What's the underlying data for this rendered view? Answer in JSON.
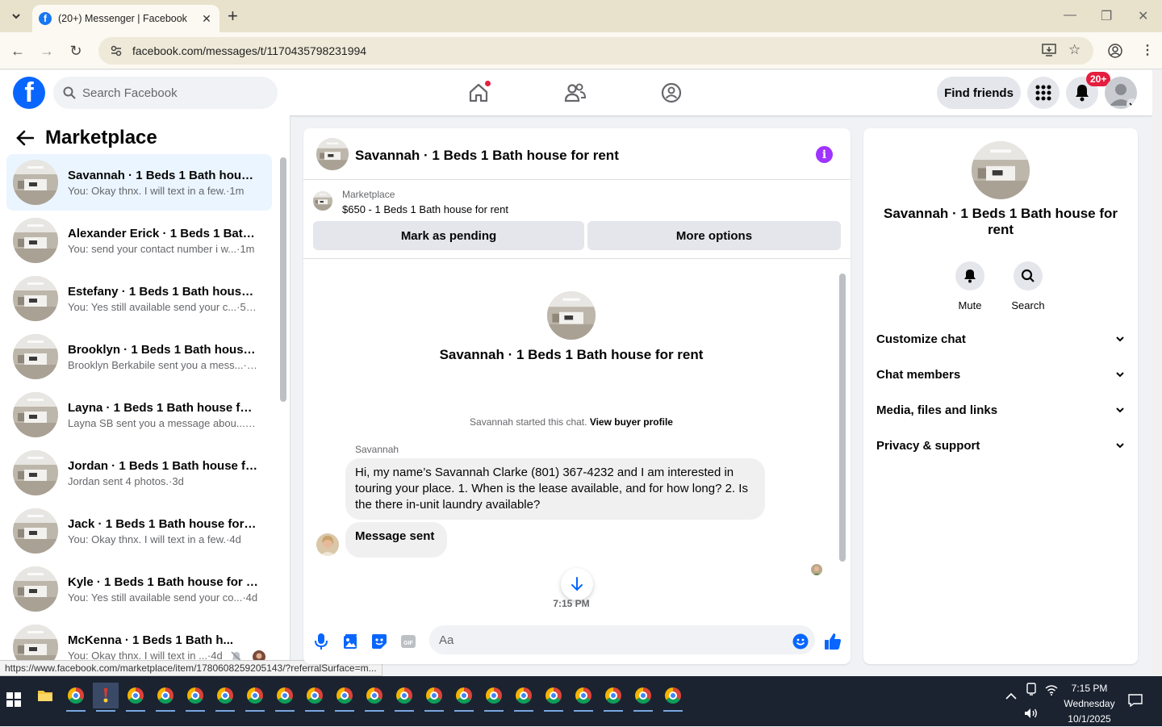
{
  "browser": {
    "tab_title": "(20+) Messenger | Facebook",
    "url": "facebook.com/messages/t/1170435798231994",
    "status_url": "https://www.facebook.com/marketplace/item/1780608259205143/?referralSurface=m..."
  },
  "header": {
    "search_placeholder": "Search Facebook",
    "find_friends": "Find friends",
    "notif_badge": "20+"
  },
  "sidebar": {
    "title": "Marketplace",
    "conversations": [
      {
        "name": "Savannah · 1 Beds 1 Bath house f...",
        "preview": "You: Okay thnx. I will text in a few.",
        "time": "1m"
      },
      {
        "name": "Alexander Erick · 1 Beds 1 Bath h...",
        "preview": "You: send your contact number i w...",
        "time": "1m"
      },
      {
        "name": "Estefany · 1 Beds 1 Bath house fo...",
        "preview": "You: Yes still available send your c...",
        "time": "50m"
      },
      {
        "name": "Brooklyn · 1 Beds 1 Bath house f...",
        "preview": "Brooklyn Berkabile sent you a mess...",
        "time": "1d"
      },
      {
        "name": "Layna · 1 Beds 1 Bath house for r...",
        "preview": "Layna SB sent you a message abou...",
        "time": "1d"
      },
      {
        "name": "Jordan · 1 Beds 1 Bath house for ...",
        "preview": "Jordan sent 4 photos.",
        "time": "3d"
      },
      {
        "name": "Jack · 1 Beds 1 Bath house for rent",
        "preview": "You: Okay thnx. I will text in a few.",
        "time": "4d"
      },
      {
        "name": "Kyle · 1 Beds 1 Bath house for rent",
        "preview": "You: Yes still available send your co...",
        "time": "4d"
      },
      {
        "name": "McKenna · 1 Beds 1 Bath h...",
        "preview": "You: Okay thnx. I will text in ...",
        "time": "4d"
      }
    ]
  },
  "chat": {
    "title": "Savannah · 1 Beds 1 Bath house for rent",
    "marketplace_label": "Marketplace",
    "listing": "$650 - 1 Beds 1 Bath house for rent",
    "mark_pending": "Mark as pending",
    "more_options": "More options",
    "intro_title": "Savannah · 1 Beds 1 Bath house for rent",
    "started_text": "Savannah started this chat.",
    "view_buyer": "View buyer profile",
    "sender": "Savannah",
    "message1": "Hi, my name’s Savannah Clarke (801) 367-4232 and I am interested in touring your place. 1. When is the lease available, and for how long? 2. Is the there in-unit laundry available?",
    "message2": "Message sent",
    "timestamp": "7:15 PM",
    "composer_placeholder": "Aa"
  },
  "details": {
    "name": "Savannah · 1 Beds 1 Bath house for rent",
    "mute": "Mute",
    "search": "Search",
    "sections": [
      "Customize chat",
      "Chat members",
      "Media, files and links",
      "Privacy & support"
    ]
  },
  "taskbar": {
    "time": "7:15 PM",
    "day": "Wednesday",
    "date": "10/1/2025"
  },
  "colors": {
    "fb_blue": "#0866ff",
    "active_row": "#ebf5ff",
    "info_purple": "#a033ff",
    "badge_red": "#e41e3f"
  }
}
